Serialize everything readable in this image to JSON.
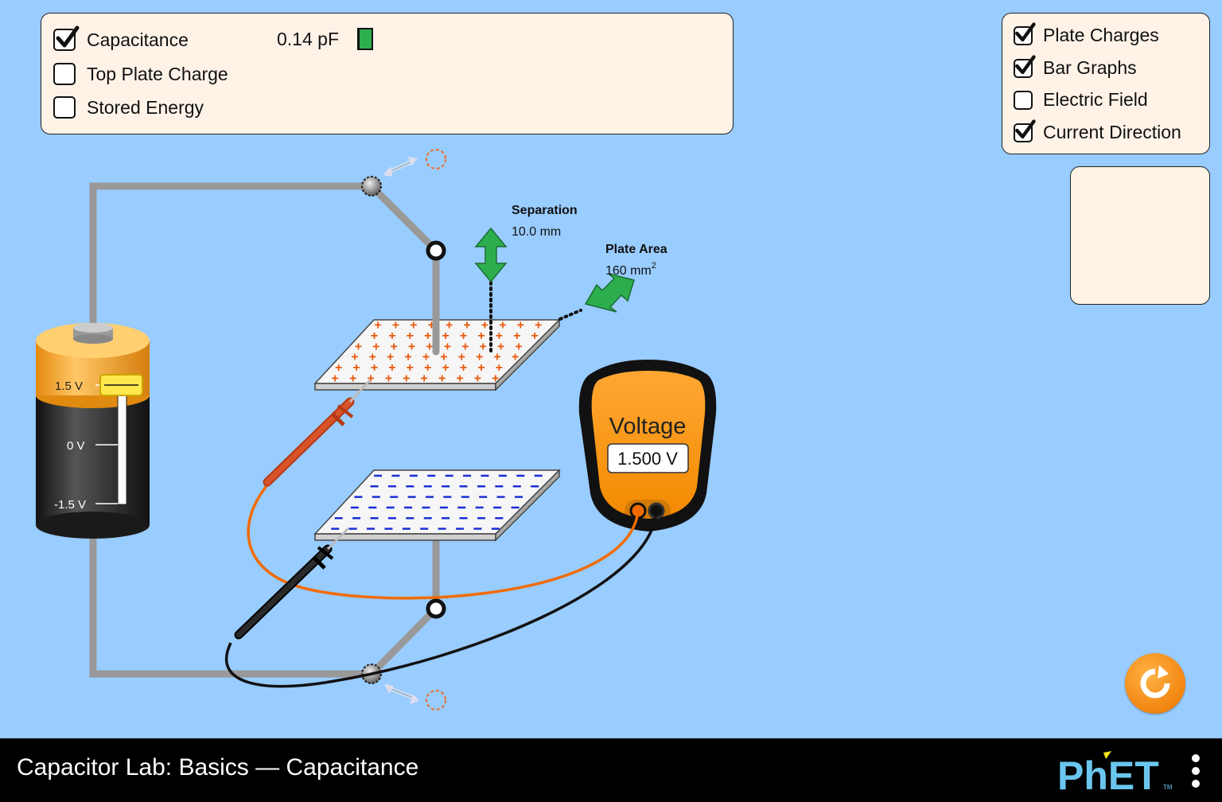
{
  "app": {
    "title": "Capacitor Lab: Basics — Capacitance",
    "logo_text": "PhET",
    "logo_trademark": "TM"
  },
  "meters_panel": {
    "items": [
      {
        "label": "Capacitance",
        "checked": true,
        "value": "0.14 pF"
      },
      {
        "label": "Top Plate Charge",
        "checked": false
      },
      {
        "label": "Stored Energy",
        "checked": false
      }
    ]
  },
  "view_panel": {
    "items": [
      {
        "label": "Plate Charges",
        "checked": true
      },
      {
        "label": "Bar Graphs",
        "checked": true
      },
      {
        "label": "Electric Field",
        "checked": false
      },
      {
        "label": "Current Direction",
        "checked": true
      }
    ]
  },
  "capacitor": {
    "separation_label": "Separation",
    "separation_value": "10.0 mm",
    "plate_area_label": "Plate Area",
    "plate_area_value": "160 mm",
    "plate_area_unit_exp": "2"
  },
  "battery": {
    "tick_top": "1.5 V",
    "tick_mid": "0 V",
    "tick_bottom": "-1.5 V",
    "voltage_fraction": 1.0
  },
  "voltmeter": {
    "label": "Voltage",
    "reading": "1.500 V"
  },
  "colors": {
    "background": "#99ccff",
    "panel": "#fff3e8",
    "positive": "#e8590c",
    "negative": "#1a2fd6",
    "accent_green": "#2dae4e",
    "reset": "#f2850f"
  },
  "icons": {
    "reset": "reset-icon",
    "menu": "kebab-menu-icon"
  }
}
